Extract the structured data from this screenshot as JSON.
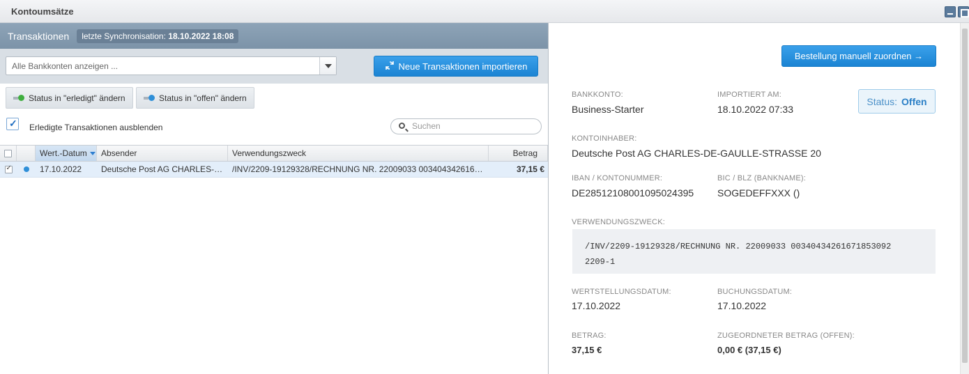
{
  "window": {
    "title": "Kontoumsätze"
  },
  "left": {
    "title": "Transaktionen",
    "sync_label": "letzte Synchronisation:",
    "sync_value": "18.10.2022 18:08",
    "account_select": "Alle Bankkonten anzeigen ...",
    "import_button": "Neue Transaktionen importieren",
    "status_done_button": "Status in \"erledigt\" ändern",
    "status_open_button": "Status in \"offen\" ändern",
    "hide_done_label": "Erledigte Transaktionen ausblenden",
    "search_placeholder": "Suchen",
    "columns": {
      "date": "Wert.-Datum",
      "sender": "Absender",
      "purpose": "Verwendungszweck",
      "amount": "Betrag"
    },
    "rows": [
      {
        "date": "17.10.2022",
        "sender": "Deutsche Post AG CHARLES-DE-GAULLE-STRASSE 20",
        "purpose": "/INV/2209-19129328/RECHNUNG NR. 22009033 00340434261671853092 2209-1",
        "amount": "37,15 €"
      }
    ]
  },
  "right": {
    "assign_button": "Bestellung manuell zuordnen →",
    "bank_account_label": "BANKKONTO:",
    "bank_account_value": "Business-Starter",
    "imported_label": "IMPORTIERT AM:",
    "imported_value": "18.10.2022 07:33",
    "status_label": "Status:",
    "status_value": "Offen",
    "holder_label": "KONTOINHABER:",
    "holder_value": "Deutsche Post AG CHARLES-DE-GAULLE-STRASSE 20",
    "iban_label": "IBAN / KONTONUMMER:",
    "iban_value": "DE28512108001095024395",
    "bic_label": "BIC / BLZ (BANKNAME):",
    "bic_value": "SOGEDEFFXXX ()",
    "purpose_label": "VERWENDUNGSZWECK:",
    "purpose_line1": "/INV/2209-19129328/RECHNUNG NR. 22009033 00340434261671853092",
    "purpose_line2": "2209-1",
    "value_date_label": "WERTSTELLUNGSDATUM:",
    "value_date_value": "17.10.2022",
    "booking_date_label": "BUCHUNGSDATUM:",
    "booking_date_value": "17.10.2022",
    "amount_label": "BETRAG:",
    "amount_value": "37,15 €",
    "assigned_label": "ZUGEORDNETER BETRAG (OFFEN):",
    "assigned_value": "0,00 € (37,15 €)"
  }
}
